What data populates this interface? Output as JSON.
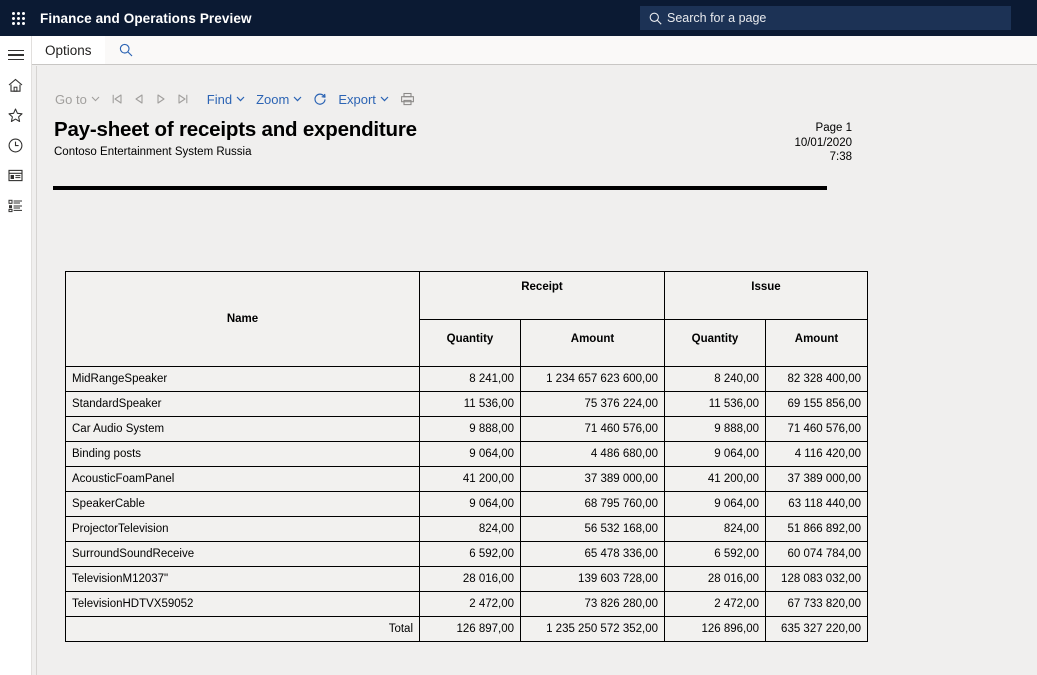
{
  "top_bar": {
    "waffle_icon": "waffle-grid-icon",
    "app_title": "Finance and Operations Preview",
    "search": {
      "icon": "search-icon",
      "placeholder": "Search for a page",
      "value": "Search for a page"
    }
  },
  "left_rail": {
    "items": [
      {
        "icon": "hamburger-menu-icon",
        "name": "navigation-menu"
      },
      {
        "icon": "home-icon",
        "name": "home"
      },
      {
        "icon": "star-icon",
        "name": "favorites"
      },
      {
        "icon": "clock-icon",
        "name": "recent"
      },
      {
        "icon": "workspace-icon",
        "name": "workspaces"
      },
      {
        "icon": "list-icon",
        "name": "modules"
      }
    ]
  },
  "options_bar": {
    "tab_label": "Options",
    "search_icon": "search-icon"
  },
  "report_toolbar": {
    "go_to": "Go to",
    "first_page_icon": "first-page-icon",
    "prev_page_icon": "previous-page-icon",
    "next_page_icon": "next-page-icon",
    "last_page_icon": "last-page-icon",
    "find": "Find",
    "zoom": "Zoom",
    "refresh_icon": "refresh-icon",
    "export": "Export",
    "print_icon": "print-icon"
  },
  "report": {
    "title": "Pay-sheet of receipts and expenditure",
    "subtitle": "Contoso Entertainment System Russia",
    "page_label": "Page 1",
    "date": "10/01/2020",
    "time": "7:38"
  },
  "table": {
    "headers": {
      "name": "Name",
      "receipt": "Receipt",
      "issue": "Issue",
      "quantity": "Quantity",
      "amount": "Amount"
    },
    "rows": [
      {
        "name": "MidRangeSpeaker",
        "receipt_qty": "8 241,00",
        "receipt_amt": "1 234 657 623 600,00",
        "issue_qty": "8 240,00",
        "issue_amt": "82 328 400,00"
      },
      {
        "name": "StandardSpeaker",
        "receipt_qty": "11 536,00",
        "receipt_amt": "75 376 224,00",
        "issue_qty": "11 536,00",
        "issue_amt": "69 155 856,00"
      },
      {
        "name": "Car Audio System",
        "receipt_qty": "9 888,00",
        "receipt_amt": "71 460 576,00",
        "issue_qty": "9 888,00",
        "issue_amt": "71 460 576,00"
      },
      {
        "name": "Binding posts",
        "receipt_qty": "9 064,00",
        "receipt_amt": "4 486 680,00",
        "issue_qty": "9 064,00",
        "issue_amt": "4 116 420,00"
      },
      {
        "name": "AcousticFoamPanel",
        "receipt_qty": "41 200,00",
        "receipt_amt": "37 389 000,00",
        "issue_qty": "41 200,00",
        "issue_amt": "37 389 000,00"
      },
      {
        "name": "SpeakerCable",
        "receipt_qty": "9 064,00",
        "receipt_amt": "68 795 760,00",
        "issue_qty": "9 064,00",
        "issue_amt": "63 118 440,00"
      },
      {
        "name": "ProjectorTelevision",
        "receipt_qty": "824,00",
        "receipt_amt": "56 532 168,00",
        "issue_qty": "824,00",
        "issue_amt": "51 866 892,00"
      },
      {
        "name": "SurroundSoundReceive",
        "receipt_qty": "6 592,00",
        "receipt_amt": "65 478 336,00",
        "issue_qty": "6 592,00",
        "issue_amt": "60 074 784,00"
      },
      {
        "name": "TelevisionM12037\"",
        "receipt_qty": "28 016,00",
        "receipt_amt": "139 603 728,00",
        "issue_qty": "28 016,00",
        "issue_amt": "128 083 032,00"
      },
      {
        "name": "TelevisionHDTVX59052",
        "receipt_qty": "2 472,00",
        "receipt_amt": "73 826 280,00",
        "issue_qty": "2 472,00",
        "issue_amt": "67 733 820,00"
      }
    ],
    "total": {
      "label": "Total",
      "receipt_qty": "126 897,00",
      "receipt_amt": "1 235 250 572 352,00",
      "issue_qty": "126 896,00",
      "issue_amt": "635 327 220,00"
    }
  },
  "colors": {
    "top_bar": "#0b1a33",
    "link": "#2929d6",
    "toolbar_link": "#2c64b4",
    "page_background": "#f0efee",
    "table_background": "#f2f1ef"
  }
}
